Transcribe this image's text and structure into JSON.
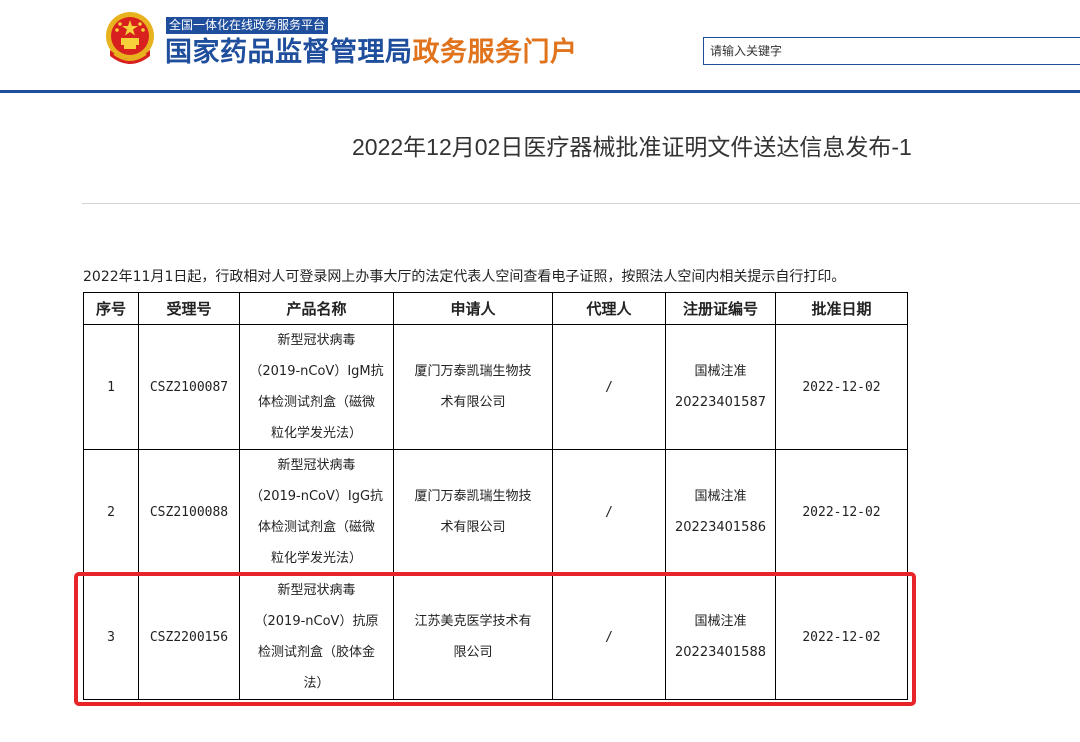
{
  "header": {
    "platform_tag": "全国一体化在线政务服务平台",
    "title_main": "国家药品监督管理局",
    "title_accent": "政务服务门户",
    "search_placeholder": "请输入关键字",
    "emblem_icon": "national-emblem-icon",
    "brand_color": "#1f4e9c",
    "accent_color": "#e0731c"
  },
  "article": {
    "title": "2022年12月02日医疗器械批准证明文件送达信息发布-1",
    "notice": "2022年11月1日起，行政相对人可登录网上办事大厅的法定代表人空间查看电子证照，按照法人空间内相关提示自行打印。"
  },
  "table": {
    "headers": [
      "序号",
      "受理号",
      "产品名称",
      "申请人",
      "代理人",
      "注册证编号",
      "批准日期"
    ],
    "rows": [
      {
        "index": "1",
        "accept_no": "CSZ2100087",
        "product_lines": [
          "新型冠状病毒",
          "（2019-nCoV）IgM抗",
          "体检测试剂盒（磁微",
          "粒化学发光法）"
        ],
        "applicant_lines": [
          "厦门万泰凯瑞生物技",
          "术有限公司"
        ],
        "agent": "/",
        "reg_lines": [
          "国械注准",
          "20223401587"
        ],
        "date": "2022-12-02"
      },
      {
        "index": "2",
        "accept_no": "CSZ2100088",
        "product_lines": [
          "新型冠状病毒",
          "（2019-nCoV）IgG抗",
          "体检测试剂盒（磁微",
          "粒化学发光法）"
        ],
        "applicant_lines": [
          "厦门万泰凯瑞生物技",
          "术有限公司"
        ],
        "agent": "/",
        "reg_lines": [
          "国械注准",
          "20223401586"
        ],
        "date": "2022-12-02"
      },
      {
        "index": "3",
        "accept_no": "CSZ2200156",
        "product_lines": [
          "新型冠状病毒",
          "（2019-nCoV）抗原",
          "检测试剂盒（胶体金",
          "法）"
        ],
        "applicant_lines": [
          "江苏美克医学技术有",
          "限公司"
        ],
        "agent": "/",
        "reg_lines": [
          "国械注准",
          "20223401588"
        ],
        "date": "2022-12-02"
      }
    ]
  },
  "highlight": {
    "target_row": "3",
    "color": "#e6242a"
  }
}
